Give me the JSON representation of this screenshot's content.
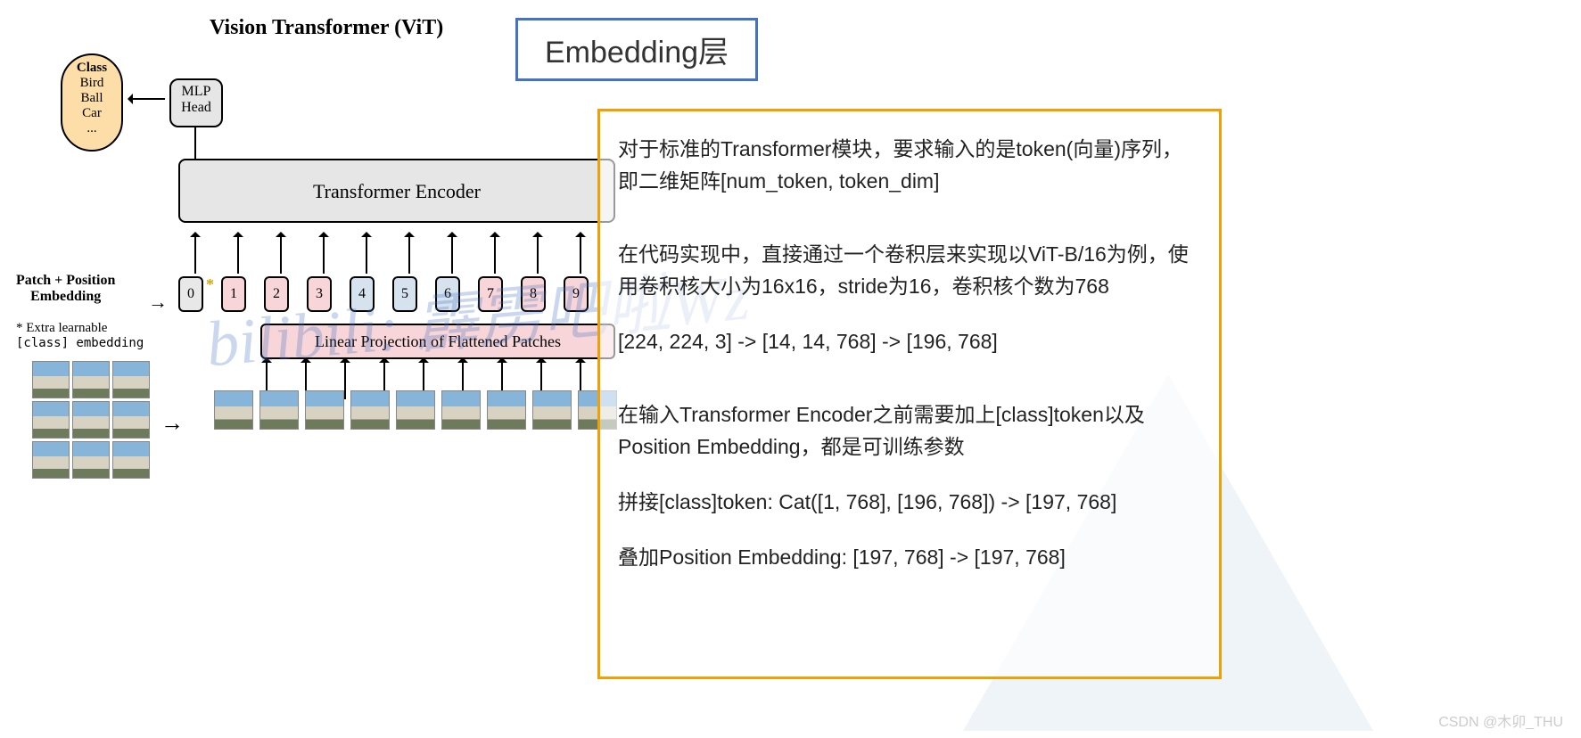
{
  "title": "Vision Transformer (ViT)",
  "embed_title": "Embedding层",
  "class_box": {
    "header": "Class",
    "items": [
      "Bird",
      "Ball",
      "Car",
      "..."
    ]
  },
  "mlp": {
    "l1": "MLP",
    "l2": "Head"
  },
  "encoder": "Transformer Encoder",
  "tokens": [
    "0",
    "1",
    "2",
    "3",
    "4",
    "5",
    "6",
    "7",
    "8",
    "9"
  ],
  "ppe": {
    "l1": "Patch + Position",
    "l2": "Embedding"
  },
  "footnote": {
    "l1": "* Extra learnable",
    "l2": "[class] embedding"
  },
  "linproj": "Linear Projection of Flattened Patches",
  "watermark": "bilibili: 霹雳吧啦Wz",
  "csdn": "CSDN @木卯_THU",
  "right": {
    "p1": "对于标准的Transformer模块，要求输入的是token(向量)序列，即二维矩阵[num_token, token_dim]",
    "p2": "在代码实现中，直接通过一个卷积层来实现以ViT-B/16为例，使用卷积核大小为16x16，stride为16，卷积核个数为768",
    "p3": "[224, 224, 3] -> [14, 14, 768] -> [196, 768]",
    "p4": "在输入Transformer Encoder之前需要加上[class]token以及Position Embedding，都是可训练参数",
    "p5": "拼接[class]token:   Cat([1, 768], [196, 768]) -> [197, 768]",
    "p6": "叠加Position Embedding:   [197, 768] -> [197, 768]"
  }
}
